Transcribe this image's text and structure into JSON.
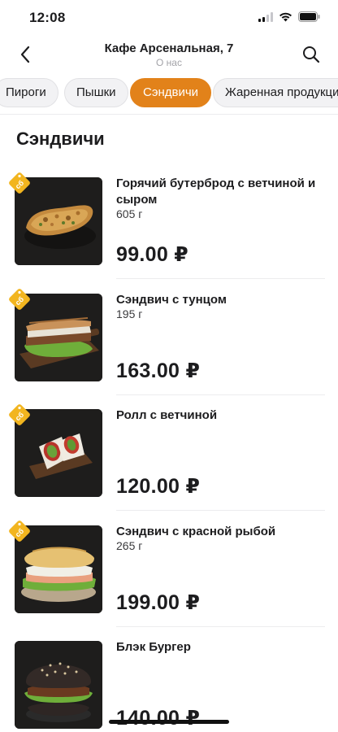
{
  "status_bar": {
    "time": "12:08"
  },
  "header": {
    "title": "Кафе Арсенальная, 7",
    "subtitle": "О нас",
    "back_icon": "chevron-left-icon",
    "search_icon": "search-icon"
  },
  "categories": {
    "items": [
      {
        "label": "Пироги",
        "active": false
      },
      {
        "label": "Пышки",
        "active": false
      },
      {
        "label": "Сэндвичи",
        "active": true
      },
      {
        "label": "Жаренная продукция",
        "active": false
      }
    ],
    "accent_color": "#e2821a"
  },
  "section": {
    "title": "Сэндвичи"
  },
  "products": [
    {
      "name": "Горячий бутерброд с ветчиной и сыром",
      "weight": "605 г",
      "price": "99.00 ₽",
      "badge": "сб"
    },
    {
      "name": "Сэндвич с тунцом",
      "weight": "195 г",
      "price": "163.00 ₽",
      "badge": "сб"
    },
    {
      "name": "Ролл с ветчиной",
      "weight": "",
      "price": "120.00 ₽",
      "badge": "сб"
    },
    {
      "name": "Сэндвич с красной рыбой",
      "weight": "265 г",
      "price": "199.00 ₽",
      "badge": "сб"
    },
    {
      "name": "Блэк Бургер",
      "weight": "",
      "price": "140.00 ₽",
      "badge": ""
    }
  ]
}
